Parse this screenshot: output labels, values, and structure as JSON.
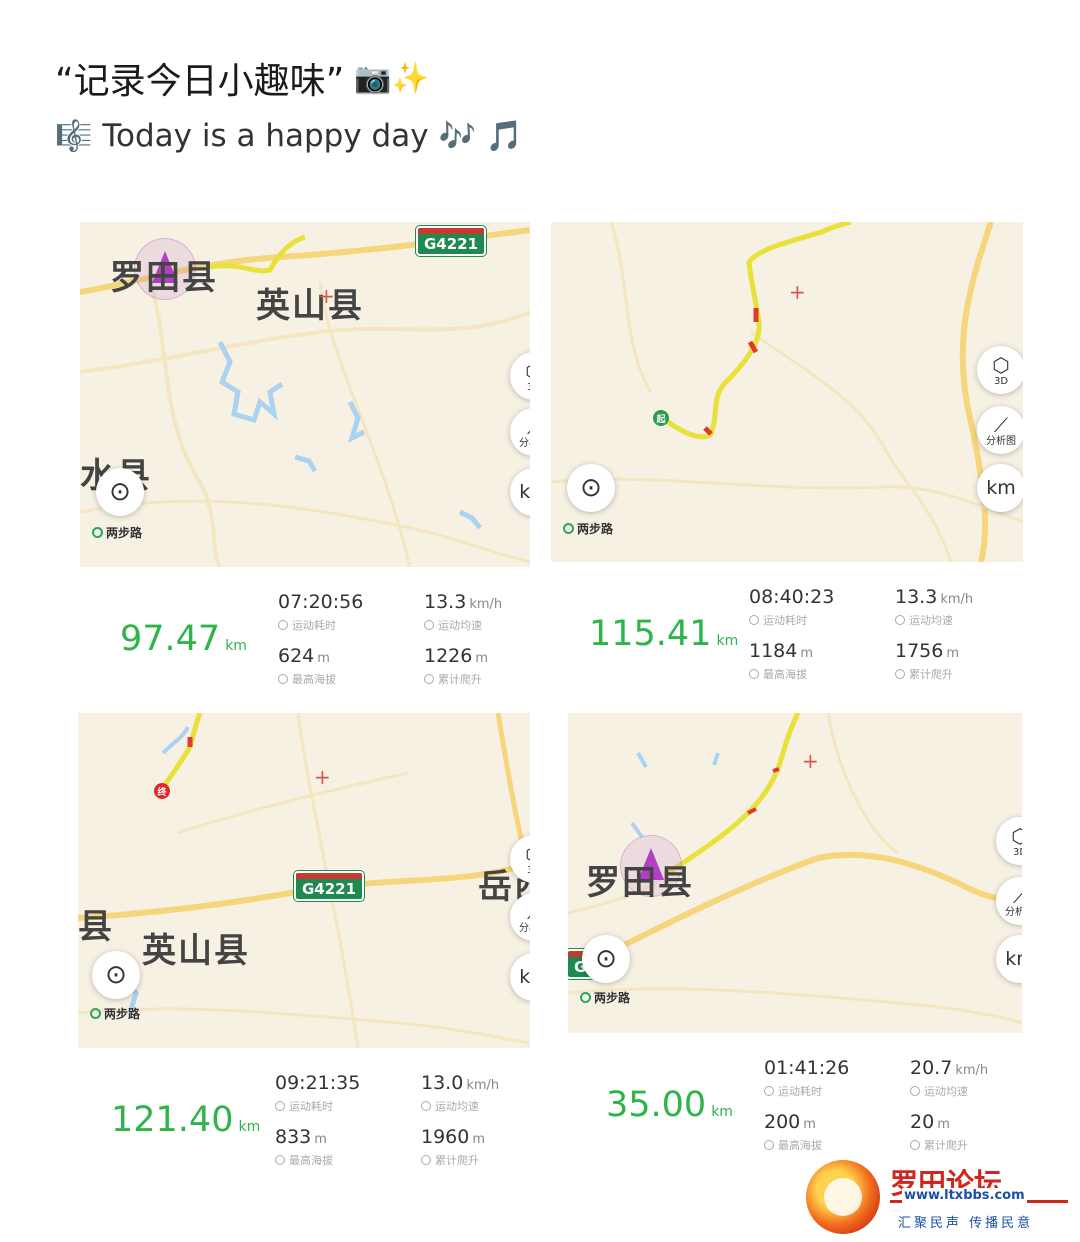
{
  "header": {
    "title": "“记录今日小趣味”",
    "title_emojis": "📷✨",
    "subtitle_prefix": "🎼",
    "subtitle": "Today is a happy day",
    "subtitle_suffix": "🎶 🎵"
  },
  "map_ui": {
    "brand": "两步路",
    "btn_3d": "3D",
    "btn_analysis": "分析图",
    "btn_km": "km",
    "start_marker": "起",
    "end_marker": "终"
  },
  "cards": [
    {
      "map_labels": [
        "罗田县",
        "英山县",
        "水县"
      ],
      "highway": "G4221",
      "distance": "97.47",
      "distance_unit": "km",
      "duration": "07:20:56",
      "duration_label": "运动耗时",
      "speed": "13.3",
      "speed_unit": "km/h",
      "speed_label": "运动均速",
      "max_alt": "624",
      "max_alt_unit": "m",
      "max_alt_label": "最高海拔",
      "climb": "1226",
      "climb_unit": "m",
      "climb_label": "累计爬升"
    },
    {
      "map_labels": [],
      "highway": "",
      "distance": "115.41",
      "distance_unit": "km",
      "duration": "08:40:23",
      "duration_label": "运动耗时",
      "speed": "13.3",
      "speed_unit": "km/h",
      "speed_label": "运动均速",
      "max_alt": "1184",
      "max_alt_unit": "m",
      "max_alt_label": "最高海拔",
      "climb": "1756",
      "climb_unit": "m",
      "climb_label": "累计爬升"
    },
    {
      "map_labels": [
        "英山县",
        "县",
        "岳西"
      ],
      "highway": "G4221",
      "distance": "121.40",
      "distance_unit": "km",
      "duration": "09:21:35",
      "duration_label": "运动耗时",
      "speed": "13.0",
      "speed_unit": "km/h",
      "speed_label": "运动均速",
      "max_alt": "833",
      "max_alt_unit": "m",
      "max_alt_label": "最高海拔",
      "climb": "1960",
      "climb_unit": "m",
      "climb_label": "累计爬升"
    },
    {
      "map_labels": [
        "罗田县"
      ],
      "highway": "G",
      "distance": "35.00",
      "distance_unit": "km",
      "duration": "01:41:26",
      "duration_label": "运动耗时",
      "speed": "20.7",
      "speed_unit": "km/h",
      "speed_label": "运动均速",
      "max_alt": "200",
      "max_alt_unit": "m",
      "max_alt_label": "最高海拔",
      "climb": "20",
      "climb_unit": "m",
      "climb_label": "累计爬升"
    }
  ],
  "watermark": {
    "title": "罗田论坛",
    "url": "www.ltxbbs.com",
    "slogan": "汇聚民声 传播民意"
  },
  "colors": {
    "distance": "#2fb44a",
    "map_bg": "#f6f1e3",
    "road": "#f6d57c",
    "water": "#a9d3f0",
    "brand_red": "#d0261d"
  }
}
